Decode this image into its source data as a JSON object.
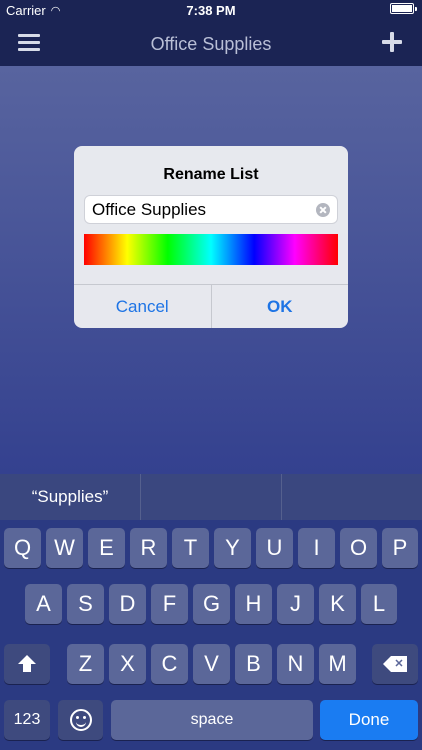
{
  "status_bar": {
    "carrier": "Carrier",
    "time": "7:38 PM"
  },
  "nav": {
    "title": "Office Supplies",
    "menu_icon": "menu-icon",
    "add_icon": "plus-icon"
  },
  "dialog": {
    "title": "Rename List",
    "input_value": "Office Supplies",
    "cancel_label": "Cancel",
    "ok_label": "OK"
  },
  "keyboard": {
    "suggestions": [
      "“Supplies”",
      "",
      ""
    ],
    "row1": [
      "Q",
      "W",
      "E",
      "R",
      "T",
      "Y",
      "U",
      "I",
      "O",
      "P"
    ],
    "row2": [
      "A",
      "S",
      "D",
      "F",
      "G",
      "H",
      "J",
      "K",
      "L"
    ],
    "row3": [
      "Z",
      "X",
      "C",
      "V",
      "B",
      "N",
      "M"
    ],
    "numbers_label": "123",
    "space_label": "space",
    "done_label": "Done"
  },
  "colors": {
    "accent": "#1e74e5",
    "done": "#1a7cf2",
    "nav": "#1b2454"
  }
}
